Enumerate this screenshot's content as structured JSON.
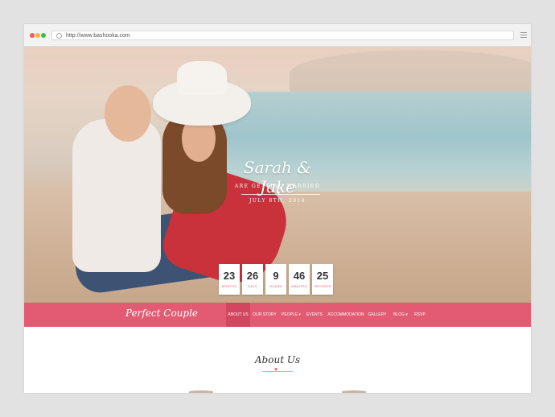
{
  "browser": {
    "url": "http://www.bashooka.com"
  },
  "hero": {
    "names": "Sarah & Jake",
    "subtitle": "ARE GETTING MARRIED",
    "date": "JULY 8TH, 2014",
    "countdown": [
      {
        "value": "23",
        "label": "MONTHS"
      },
      {
        "value": "26",
        "label": "DAYS"
      },
      {
        "value": "9",
        "label": "HOURS"
      },
      {
        "value": "46",
        "label": "MINUTES"
      },
      {
        "value": "25",
        "label": "SECONDS"
      }
    ]
  },
  "nav": {
    "brand": "Perfect Couple",
    "items": [
      {
        "label": "ABOUT US"
      },
      {
        "label": "OUR STORY"
      },
      {
        "label": "PEOPLE ▾"
      },
      {
        "label": "EVENTS"
      },
      {
        "label": "ACCOMMODATION"
      },
      {
        "label": "GALLERY"
      },
      {
        "label": "BLOG ▾"
      },
      {
        "label": "RSVP"
      }
    ]
  },
  "content": {
    "section_title": "About Us"
  },
  "colors": {
    "accent": "#e25b72",
    "accent_active": "#d24660"
  }
}
